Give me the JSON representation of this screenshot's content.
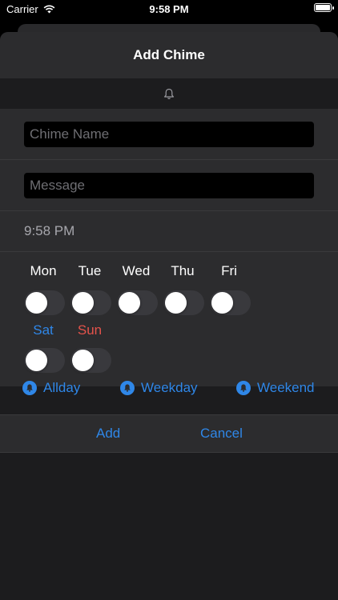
{
  "status": {
    "carrier": "Carrier",
    "time": "9:58 PM"
  },
  "sheet": {
    "title": "Add Chime"
  },
  "form": {
    "name_placeholder": "Chime Name",
    "message_placeholder": "Message",
    "time": "9:58 PM"
  },
  "days": {
    "weekdays": [
      {
        "label": "Mon",
        "on": false
      },
      {
        "label": "Tue",
        "on": false
      },
      {
        "label": "Wed",
        "on": false
      },
      {
        "label": "Thu",
        "on": false
      },
      {
        "label": "Fri",
        "on": false
      }
    ],
    "weekend": [
      {
        "label": "Sat",
        "on": false
      },
      {
        "label": "Sun",
        "on": false
      }
    ]
  },
  "presets": {
    "allday": "Allday",
    "weekday": "Weekday",
    "weekend": "Weekend"
  },
  "actions": {
    "add": "Add",
    "cancel": "Cancel"
  },
  "colors": {
    "accent": "#2f87e8",
    "sunday": "#e5534b",
    "sheet": "#2c2c2e"
  },
  "icons": [
    "wifi-icon",
    "battery-icon",
    "bell-icon",
    "bell-filled-icon"
  ]
}
